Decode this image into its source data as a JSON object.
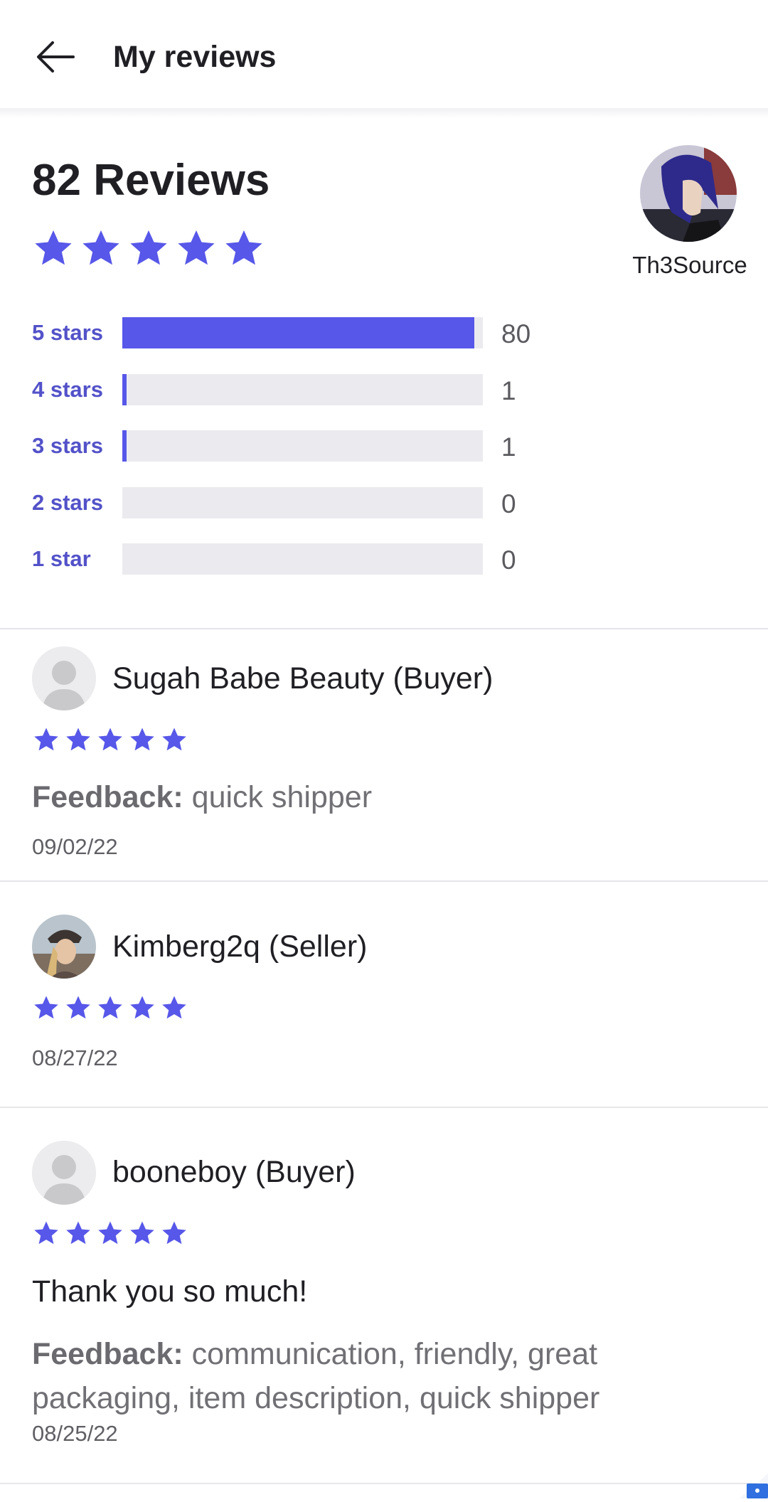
{
  "header": {
    "title": "My reviews",
    "back_icon": "arrow-left-icon"
  },
  "summary": {
    "title": "82 Reviews",
    "rating": 5,
    "max_rating": 5,
    "star_color": "#5757e9"
  },
  "profile": {
    "username": "Th3Source"
  },
  "histogram": [
    {
      "label": "5 stars",
      "count": "80",
      "fraction": 0.976
    },
    {
      "label": "4 stars",
      "count": "1",
      "fraction": 0.012
    },
    {
      "label": "3 stars",
      "count": "1",
      "fraction": 0.012
    },
    {
      "label": "2 stars",
      "count": "0",
      "fraction": 0
    },
    {
      "label": "1 star",
      "count": "0",
      "fraction": 0
    }
  ],
  "reviews": [
    {
      "name": "Sugah Babe Beauty (Buyer)",
      "rating": 5,
      "comment": "",
      "feedback_label": "Feedback:",
      "feedback": " quick shipper",
      "date": "09/02/22",
      "avatar": "default-user-icon"
    },
    {
      "name": "Kimberg2q (Seller)",
      "rating": 5,
      "comment": "",
      "feedback_label": "",
      "feedback": "",
      "date": "08/27/22",
      "avatar": "user-photo"
    },
    {
      "name": "booneboy (Buyer)",
      "rating": 5,
      "comment": "Thank you so much!",
      "feedback_label": "Feedback:",
      "feedback": " communication, friendly, great packaging, item description, quick shipper",
      "date": "08/25/22",
      "avatar": "default-user-icon"
    }
  ],
  "colors": {
    "accent": "#5757e9",
    "label_purple": "#5352c9",
    "track": "#ebebef",
    "corner_badge": "#2f6fe0"
  }
}
